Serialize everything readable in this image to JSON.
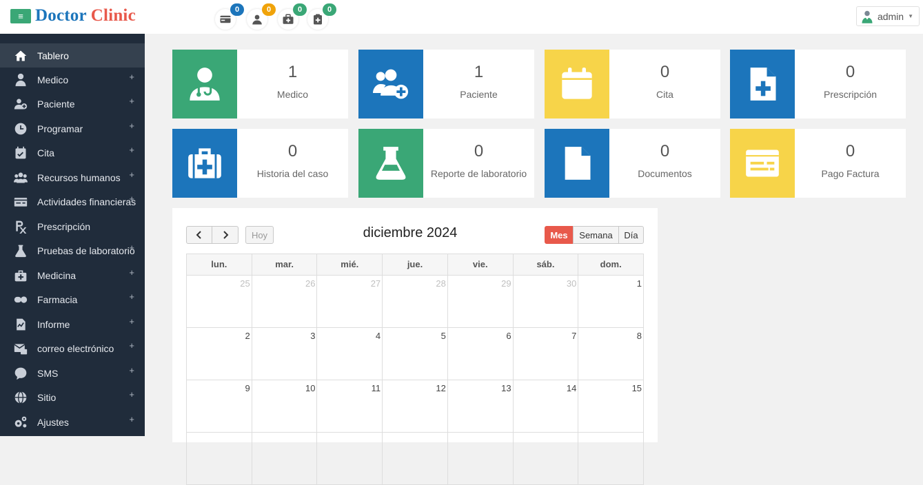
{
  "header": {
    "brand_part1": "Doctor",
    "brand_part2": "Clinic",
    "menu_toggle": "≡",
    "notifications": [
      {
        "name": "payment-notification",
        "count": "0",
        "color": "#1c75bb"
      },
      {
        "name": "patient-notification",
        "count": "0",
        "color": "#f0a30a"
      },
      {
        "name": "medical-kit-notification",
        "count": "0",
        "color": "#3aa776"
      },
      {
        "name": "prescription-notification",
        "count": "0",
        "color": "#3aa776"
      }
    ],
    "user": "admin"
  },
  "sidebar": {
    "items": [
      {
        "label": "Tablero",
        "icon": "home-icon",
        "active": true,
        "expandable": false
      },
      {
        "label": "Medico",
        "icon": "doctor-icon",
        "expandable": true
      },
      {
        "label": "Paciente",
        "icon": "add-user-icon",
        "expandable": true
      },
      {
        "label": "Programar",
        "icon": "clock-icon",
        "expandable": true
      },
      {
        "label": "Cita",
        "icon": "calendar-check-icon",
        "expandable": true
      },
      {
        "label": "Recursos humanos",
        "icon": "users-icon",
        "expandable": true
      },
      {
        "label": "Actividades financieras",
        "icon": "money-icon",
        "expandable": true
      },
      {
        "label": "Prescripción",
        "icon": "prescription-icon",
        "expandable": false
      },
      {
        "label": "Pruebas de laboratorio",
        "icon": "flask-icon",
        "expandable": true
      },
      {
        "label": "Medicina",
        "icon": "medkit-icon",
        "expandable": true
      },
      {
        "label": "Farmacia",
        "icon": "pills-icon",
        "expandable": true
      },
      {
        "label": "Informe",
        "icon": "report-icon",
        "expandable": true
      },
      {
        "label": "correo electrónico",
        "icon": "mail-icon",
        "expandable": true
      },
      {
        "label": "SMS",
        "icon": "sms-icon",
        "expandable": true
      },
      {
        "label": "Sitio",
        "icon": "globe-icon",
        "expandable": true
      },
      {
        "label": "Ajustes",
        "icon": "gears-icon",
        "expandable": true
      }
    ],
    "plus_symbol": "+"
  },
  "stats": [
    {
      "value": "1",
      "label": "Medico",
      "icon": "doctor-icon",
      "color": "#3aa776"
    },
    {
      "value": "1",
      "label": "Paciente",
      "icon": "add-users-icon",
      "color": "#1c75bb"
    },
    {
      "value": "0",
      "label": "Cita",
      "icon": "calendar-icon",
      "color": "#f7d449"
    },
    {
      "value": "0",
      "label": "Prescripción",
      "icon": "file-medical-icon",
      "color": "#1c75bb"
    },
    {
      "value": "0",
      "label": "Historia del caso",
      "icon": "medkit-icon",
      "color": "#1c75bb"
    },
    {
      "value": "0",
      "label": "Reporte de laboratorio",
      "icon": "flask-icon",
      "color": "#3aa776"
    },
    {
      "value": "0",
      "label": "Documentos",
      "icon": "document-icon",
      "color": "#1c75bb"
    },
    {
      "value": "0",
      "label": "Pago Factura",
      "icon": "credit-card-icon",
      "color": "#f7d449"
    }
  ],
  "calendar": {
    "title": "diciembre 2024",
    "prev": "<",
    "next": ">",
    "today": "Hoy",
    "views": [
      {
        "label": "Mes",
        "active": true
      },
      {
        "label": "Semana",
        "active": false
      },
      {
        "label": "Día",
        "active": false
      }
    ],
    "weekdays": [
      "lun.",
      "mar.",
      "mié.",
      "jue.",
      "vie.",
      "sáb.",
      "dom."
    ],
    "weeks": [
      [
        {
          "d": "25",
          "other": true
        },
        {
          "d": "26",
          "other": true
        },
        {
          "d": "27",
          "other": true
        },
        {
          "d": "28",
          "other": true
        },
        {
          "d": "29",
          "other": true
        },
        {
          "d": "30",
          "other": true
        },
        {
          "d": "1",
          "other": false
        }
      ],
      [
        {
          "d": "2",
          "other": false
        },
        {
          "d": "3",
          "other": false
        },
        {
          "d": "4",
          "other": false
        },
        {
          "d": "5",
          "other": false
        },
        {
          "d": "6",
          "other": false
        },
        {
          "d": "7",
          "other": false
        },
        {
          "d": "8",
          "other": false
        }
      ],
      [
        {
          "d": "9",
          "other": false
        },
        {
          "d": "10",
          "other": false
        },
        {
          "d": "11",
          "other": false
        },
        {
          "d": "12",
          "other": false
        },
        {
          "d": "13",
          "other": false
        },
        {
          "d": "14",
          "other": false
        },
        {
          "d": "15",
          "other": false
        }
      ],
      [
        {
          "d": "",
          "other": false
        },
        {
          "d": "",
          "other": false
        },
        {
          "d": "",
          "other": false
        },
        {
          "d": "",
          "other": false
        },
        {
          "d": "",
          "other": false
        },
        {
          "d": "",
          "other": false
        },
        {
          "d": "",
          "other": false
        }
      ]
    ]
  }
}
